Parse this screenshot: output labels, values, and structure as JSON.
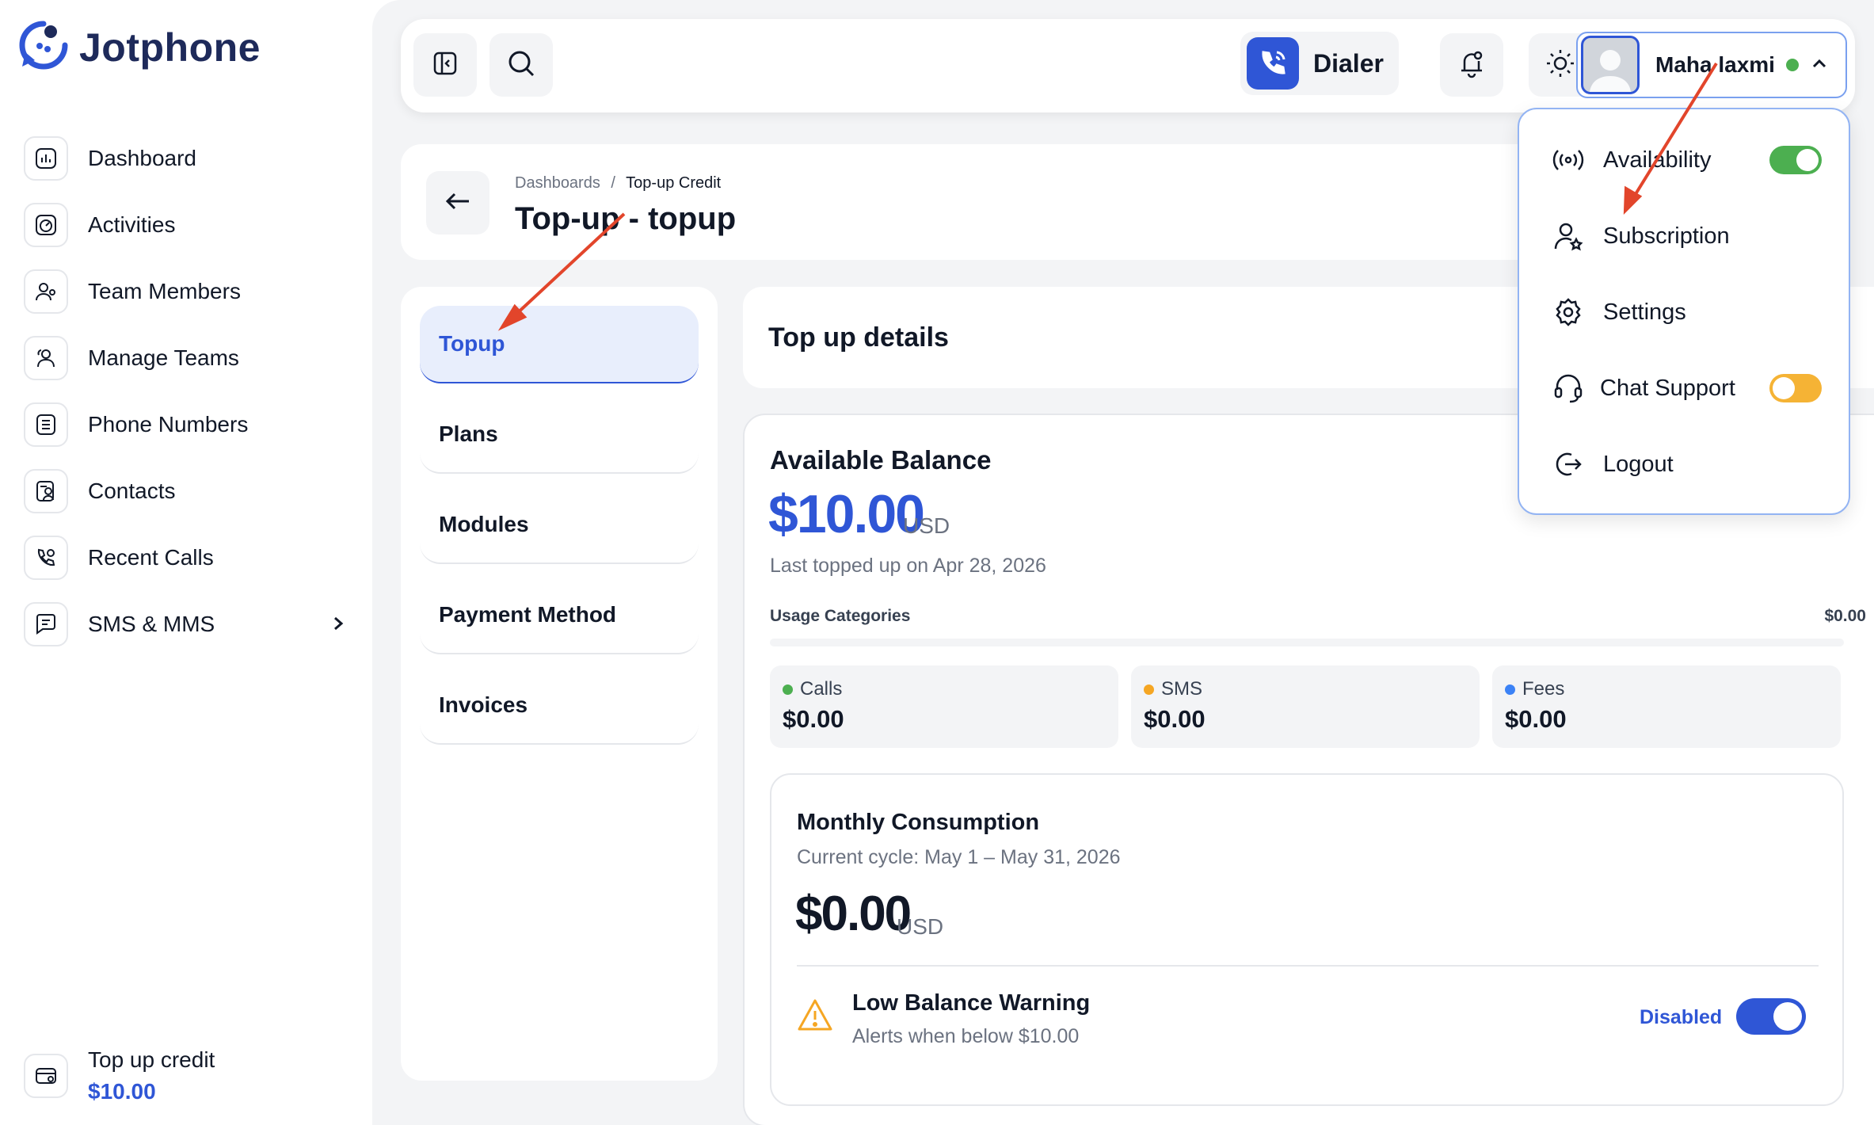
{
  "brand": {
    "name": "Jotphone"
  },
  "sidebar": {
    "items": [
      {
        "label": "Dashboard",
        "icon": "dashboard-icon"
      },
      {
        "label": "Activities",
        "icon": "activity-icon"
      },
      {
        "label": "Team Members",
        "icon": "team-members-icon"
      },
      {
        "label": "Manage Teams",
        "icon": "manage-teams-icon"
      },
      {
        "label": "Phone Numbers",
        "icon": "phone-numbers-icon"
      },
      {
        "label": "Contacts",
        "icon": "contacts-icon"
      },
      {
        "label": "Recent Calls",
        "icon": "recent-calls-icon"
      },
      {
        "label": "SMS & MMS",
        "icon": "sms-icon",
        "has_submenu": true
      }
    ],
    "credit": {
      "label": "Top up credit",
      "value": "$10.00"
    }
  },
  "topbar": {
    "dialer_label": "Dialer",
    "user_name": "Maha laxmi",
    "user_status": "online"
  },
  "header": {
    "breadcrumb": {
      "parent": "Dashboards",
      "separator": "/",
      "current": "Top-up Credit"
    },
    "title": "Top-up - topup"
  },
  "menu": {
    "items": [
      {
        "label": "Topup",
        "active": true
      },
      {
        "label": "Plans"
      },
      {
        "label": "Modules"
      },
      {
        "label": "Payment Method"
      },
      {
        "label": "Invoices"
      }
    ]
  },
  "details": {
    "title": "Top up details",
    "balance": {
      "title": "Available Balance",
      "amount": "$10.00",
      "unit": "USD",
      "last_topped": "Last topped up on Apr 28, 2026"
    },
    "usage": {
      "label": "Usage Categories",
      "total": "$0.00",
      "categories": [
        {
          "name": "Calls",
          "value": "$0.00",
          "color": "#4caf50"
        },
        {
          "name": "SMS",
          "value": "$0.00",
          "color": "#f5a623"
        },
        {
          "name": "Fees",
          "value": "$0.00",
          "color": "#3b82f6"
        }
      ]
    },
    "monthly": {
      "title": "Monthly Consumption",
      "cycle": "Current cycle: May 1 – May 31, 2026",
      "amount": "$0.00",
      "unit": "USD"
    },
    "low_balance": {
      "title": "Low Balance Warning",
      "subtitle": "Alerts when below $10.00",
      "status": "Disabled",
      "toggle_on": true
    }
  },
  "dropdown": {
    "items": [
      {
        "label": "Availability",
        "icon": "broadcast-icon",
        "toggle": "on",
        "toggle_color": "#4caf50"
      },
      {
        "label": "Subscription",
        "icon": "user-star-icon"
      },
      {
        "label": "Settings",
        "icon": "gear-icon"
      },
      {
        "label": "Chat Support",
        "icon": "headset-icon",
        "toggle": "on",
        "toggle_color": "#f5b335"
      },
      {
        "label": "Logout",
        "icon": "logout-icon"
      }
    ]
  },
  "colors": {
    "accent": "#2f56d6",
    "annotation_arrow": "#e2452b"
  }
}
